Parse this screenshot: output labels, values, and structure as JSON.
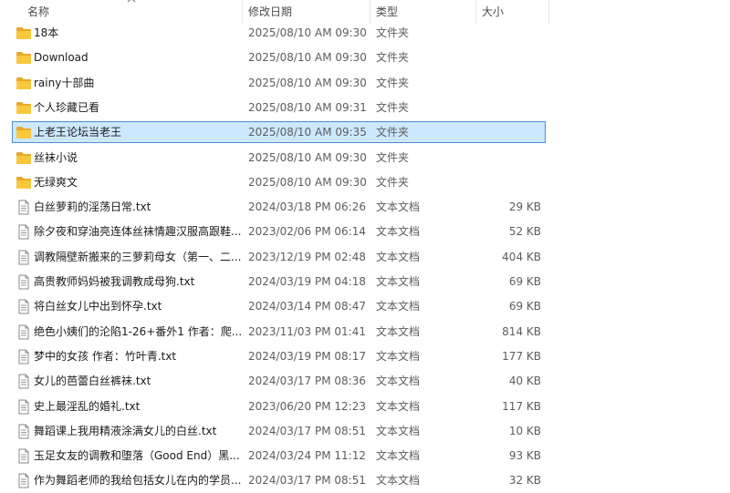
{
  "columns": {
    "name": "名称",
    "date": "修改日期",
    "type": "类型",
    "size": "大小"
  },
  "colors": {
    "selected_bg": "#cce8ff",
    "selected_border": "#4d8fd3",
    "folder_body": "#f8c83c",
    "folder_tab": "#e8a928"
  },
  "files": [
    {
      "icon": "folder-icon",
      "name": "18本",
      "date": "2025/08/10 AM 09:30",
      "type": "文件夹",
      "size": ""
    },
    {
      "icon": "folder-icon",
      "name": "Download",
      "date": "2025/08/10 AM 09:30",
      "type": "文件夹",
      "size": ""
    },
    {
      "icon": "folder-icon",
      "name": "rainy十部曲",
      "date": "2025/08/10 AM 09:30",
      "type": "文件夹",
      "size": ""
    },
    {
      "icon": "folder-icon",
      "name": "个人珍藏已看",
      "date": "2025/08/10 AM 09:31",
      "type": "文件夹",
      "size": ""
    },
    {
      "icon": "folder-icon",
      "name": "上老王论坛当老王",
      "date": "2025/08/10 AM 09:35",
      "type": "文件夹",
      "size": "",
      "selected": true
    },
    {
      "icon": "folder-icon",
      "name": "丝袜小说",
      "date": "2025/08/10 AM 09:30",
      "type": "文件夹",
      "size": ""
    },
    {
      "icon": "folder-icon",
      "name": "无绿爽文",
      "date": "2025/08/10 AM 09:30",
      "type": "文件夹",
      "size": ""
    },
    {
      "icon": "text-file-icon",
      "name": "白丝萝莉的淫荡日常.txt",
      "date": "2024/03/18 PM 06:26",
      "type": "文本文档",
      "size": "29 KB"
    },
    {
      "icon": "text-file-icon",
      "name": "除夕夜和穿油亮连体丝袜情趣汉服高跟鞋...",
      "date": "2023/02/06 PM 06:14",
      "type": "文本文档",
      "size": "52 KB"
    },
    {
      "icon": "text-file-icon",
      "name": "调教隔壁新搬来的三萝莉母女（第一、二...",
      "date": "2023/12/19 PM 02:48",
      "type": "文本文档",
      "size": "404 KB"
    },
    {
      "icon": "text-file-icon",
      "name": "高贵教师妈妈被我调教成母狗.txt",
      "date": "2024/03/19 PM 04:18",
      "type": "文本文档",
      "size": "69 KB"
    },
    {
      "icon": "text-file-icon",
      "name": "将白丝女儿中出到怀孕.txt",
      "date": "2024/03/14 PM 08:47",
      "type": "文本文档",
      "size": "69 KB"
    },
    {
      "icon": "text-file-icon",
      "name": "绝色小姨们的沦陷1-26+番外1 作者：爬...",
      "date": "2023/11/03 PM 01:41",
      "type": "文本文档",
      "size": "814 KB"
    },
    {
      "icon": "text-file-icon",
      "name": "梦中的女孩 作者：竹叶青.txt",
      "date": "2024/03/19 PM 08:17",
      "type": "文本文档",
      "size": "177 KB"
    },
    {
      "icon": "text-file-icon",
      "name": "女儿的芭蕾白丝裤袜.txt",
      "date": "2024/03/17 PM 08:36",
      "type": "文本文档",
      "size": "40 KB"
    },
    {
      "icon": "text-file-icon",
      "name": "史上最淫乱的婚礼.txt",
      "date": "2023/06/20 PM 12:23",
      "type": "文本文档",
      "size": "117 KB"
    },
    {
      "icon": "text-file-icon",
      "name": "舞蹈课上我用精液涂满女儿的白丝.txt",
      "date": "2024/03/17 PM 08:51",
      "type": "文本文档",
      "size": "10 KB"
    },
    {
      "icon": "text-file-icon",
      "name": "玉足女友的调教和堕落（Good End）黑...",
      "date": "2024/03/24 PM 11:12",
      "type": "文本文档",
      "size": "93 KB"
    },
    {
      "icon": "text-file-icon",
      "name": "作为舞蹈老师的我给包括女儿在内的学员...",
      "date": "2024/03/17 PM 08:51",
      "type": "文本文档",
      "size": "32 KB"
    }
  ]
}
